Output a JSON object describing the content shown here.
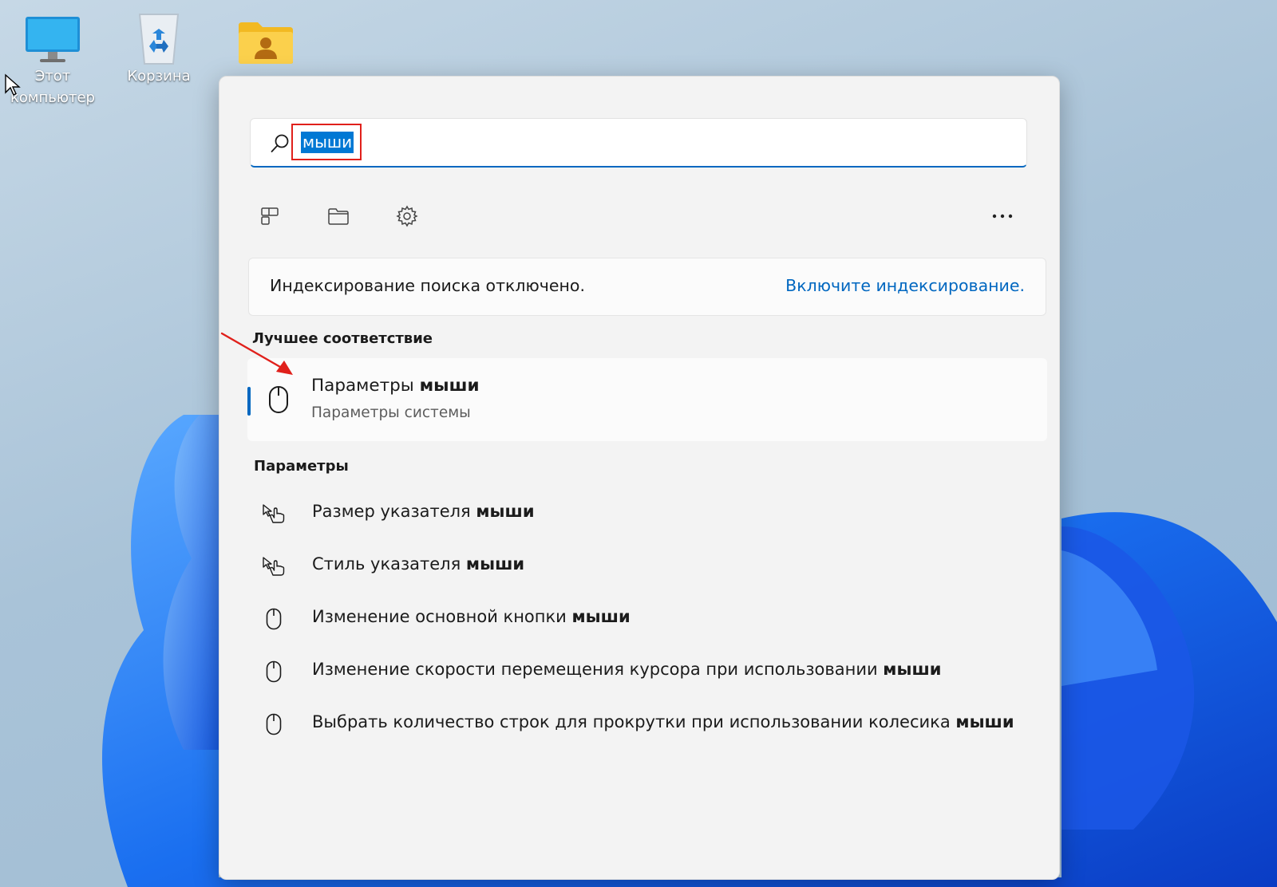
{
  "desktop": {
    "icons": [
      {
        "label": "Этот компьютер"
      },
      {
        "label": "Корзина"
      },
      {
        "label": ""
      }
    ]
  },
  "search": {
    "query": "мыши"
  },
  "notice": {
    "text": "Индексирование поиска отключено.",
    "link": "Включите индексирование."
  },
  "best_match": {
    "heading": "Лучшее соответствие",
    "title_prefix": "Параметры ",
    "title_bold": "мыши",
    "subtitle": "Параметры системы"
  },
  "settings": {
    "heading": "Параметры",
    "items": [
      {
        "prefix": "Размер указателя ",
        "bold": "мыши",
        "icon": "pointer-hand-icon"
      },
      {
        "prefix": "Стиль указателя ",
        "bold": "мыши",
        "icon": "pointer-hand-icon"
      },
      {
        "prefix": "Изменение основной кнопки ",
        "bold": "мыши",
        "icon": "mouse-icon"
      },
      {
        "prefix": "Изменение скорости перемещения курсора при использовании ",
        "bold": "мыши",
        "icon": "mouse-icon"
      },
      {
        "prefix": "Выбрать количество строк для прокрутки при использовании колесика ",
        "bold": "мыши",
        "icon": "mouse-icon"
      }
    ]
  },
  "colors": {
    "accent": "#0067c0",
    "selection": "#0078d4",
    "annotation": "#e0201b"
  }
}
